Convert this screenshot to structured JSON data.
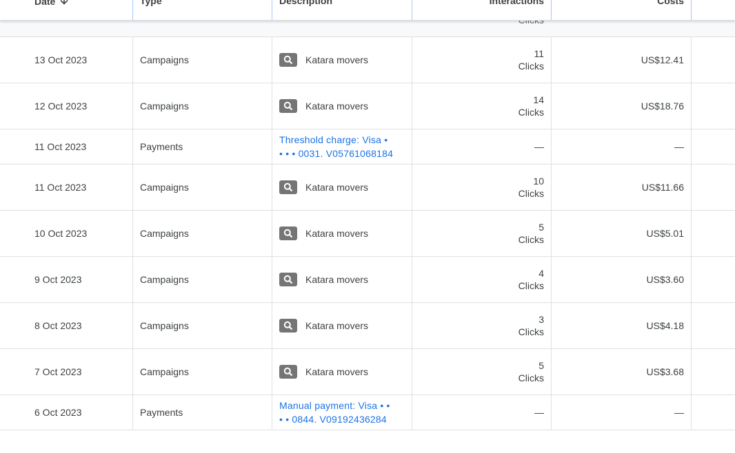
{
  "table": {
    "headers": {
      "date": "Date",
      "type": "Type",
      "description": "Description",
      "interactions": "Interactions",
      "costs": "Costs"
    },
    "clipped_previous_unit": "Clicks",
    "rows": [
      {
        "date": "13 Oct 2023",
        "type": "Campaigns",
        "description": "Katara movers",
        "interactions_value": "11",
        "interactions_unit": "Clicks",
        "cost": "US$12.41"
      },
      {
        "date": "12 Oct 2023",
        "type": "Campaigns",
        "description": "Katara movers",
        "interactions_value": "14",
        "interactions_unit": "Clicks",
        "cost": "US$18.76"
      },
      {
        "date": "11 Oct 2023",
        "type": "Payments",
        "description_line1": "Threshold charge: Visa  •",
        "description_line2": "• • • 0031. V05761068184",
        "interactions_value": "—",
        "cost": "—"
      },
      {
        "date": "11 Oct 2023",
        "type": "Campaigns",
        "description": "Katara movers",
        "interactions_value": "10",
        "interactions_unit": "Clicks",
        "cost": "US$11.66"
      },
      {
        "date": "10 Oct 2023",
        "type": "Campaigns",
        "description": "Katara movers",
        "interactions_value": "5",
        "interactions_unit": "Clicks",
        "cost": "US$5.01"
      },
      {
        "date": "9 Oct 2023",
        "type": "Campaigns",
        "description": "Katara movers",
        "interactions_value": "4",
        "interactions_unit": "Clicks",
        "cost": "US$3.60"
      },
      {
        "date": "8 Oct 2023",
        "type": "Campaigns",
        "description": "Katara movers",
        "interactions_value": "3",
        "interactions_unit": "Clicks",
        "cost": "US$4.18"
      },
      {
        "date": "7 Oct 2023",
        "type": "Campaigns",
        "description": "Katara movers",
        "interactions_value": "5",
        "interactions_unit": "Clicks",
        "cost": "US$3.68"
      },
      {
        "date": "6 Oct 2023",
        "type": "Payments",
        "description_line1": "Manual payment: Visa  • •",
        "description_line2": "• • 0844. V09192436284",
        "interactions_value": "—",
        "cost": "—"
      }
    ]
  },
  "icons": {
    "sort": "arrow-down-icon",
    "campaign": "search-icon"
  },
  "colors": {
    "link": "#1a73e8",
    "icon_badge": "#757575",
    "header_separator": "#a8c7fa"
  }
}
